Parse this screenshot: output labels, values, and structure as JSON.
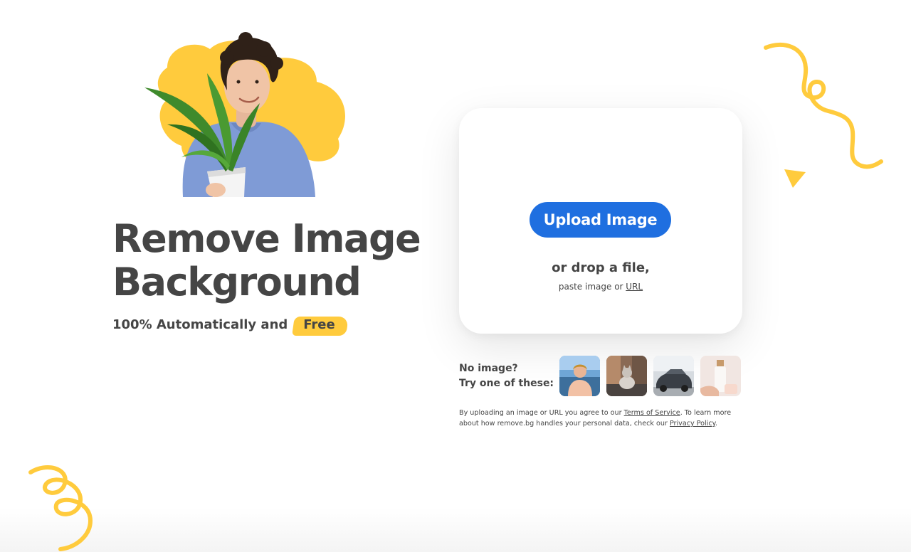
{
  "hero": {
    "title_line1": "Remove Image",
    "title_line2": "Background",
    "subtitle_prefix": "100% Automatically and",
    "subtitle_badge": "Free"
  },
  "upload": {
    "button_label": "Upload Image",
    "drop_text": "or drop a file,",
    "paste_prefix": "paste image or",
    "paste_link": "URL"
  },
  "samples": {
    "label_line1": "No image?",
    "label_line2": "Try one of these:",
    "items": [
      {
        "icon": "person-sample-icon"
      },
      {
        "icon": "cat-sample-icon"
      },
      {
        "icon": "car-sample-icon"
      },
      {
        "icon": "product-sample-icon"
      }
    ]
  },
  "legal": {
    "part1": "By uploading an image or URL you agree to our",
    "terms_link": "Terms of Service",
    "part2": ". To learn more about how remove.bg handles your personal data, check our",
    "privacy_link": "Privacy Policy",
    "part3": "."
  },
  "colors": {
    "accent": "#1f6fe0",
    "highlight": "#ffcb3d",
    "text": "#454545"
  }
}
